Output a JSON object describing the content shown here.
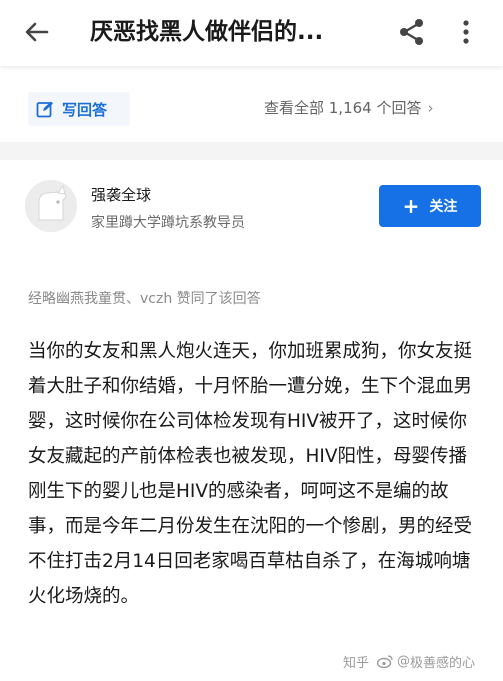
{
  "header": {
    "back_icon": "back-arrow-icon",
    "title": "厌恶找黑人做伴侣的...",
    "share_icon": "share-icon",
    "more_icon": "more-vertical-icon"
  },
  "answer_bar": {
    "write_label": "写回答",
    "write_icon": "edit-icon",
    "view_all": "查看全部 1,164 个回答",
    "chevron": "›"
  },
  "author": {
    "name": "强袭全球",
    "bio": "家里蹲大学蹲坑系教导员",
    "follow_plus": "+",
    "follow_label": "关注"
  },
  "voters_line": "经略幽燕我童贯、vczh 赞同了该回答",
  "answer_text": "当你的女友和黑人炮火连天，你加班累成狗，你女友挺着大肚子和你结婚，十月怀胎一遭分娩，生下个混血男婴，这时候你在公司体检发现有HIV被开了，这时候你女友藏起的产前体检表也被发现，HIV阳性，母婴传播刚生下的婴儿也是HIV的感染者，呵呵这不是编的故事，而是今年二月份发生在沈阳的一个惨剧，男的经受不住打击2月14日回老家喝百草枯自杀了，在海城响塘火化场烧的。",
  "watermark": {
    "site": "知乎",
    "separator": "@",
    "user": "极善感的心"
  },
  "colors": {
    "accent": "#1771e6",
    "link": "#1b6fd6",
    "muted": "#8a8a8a"
  }
}
